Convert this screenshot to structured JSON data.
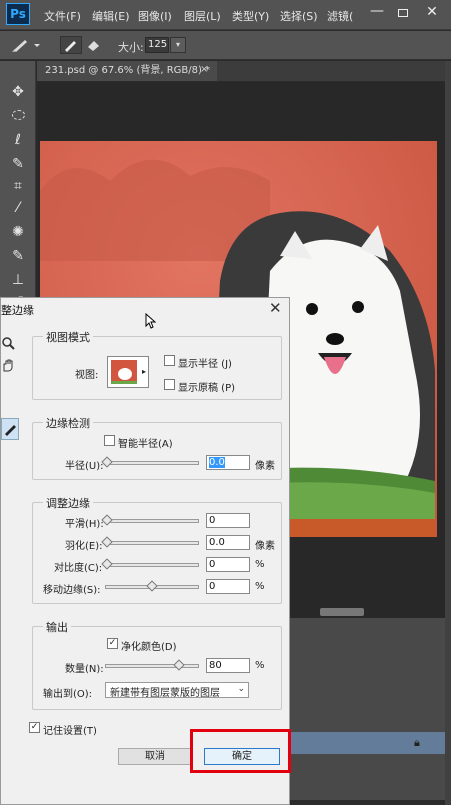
{
  "app": {
    "logo": "Ps",
    "menus": [
      "文件(F)",
      "编辑(E)",
      "图像(I)",
      "图层(L)",
      "类型(Y)",
      "选择(S)",
      "滤镜("
    ],
    "window_controls": {
      "minimize": "—",
      "close": "✕"
    }
  },
  "options_bar": {
    "size_label": "大小:",
    "size_value": "125",
    "dropdown_arrow": "▾"
  },
  "document": {
    "tab_title": "231.psd @ 67.6% (背景, RGB/8) *",
    "tab_close": "×"
  },
  "dialog": {
    "title": "整边缘",
    "close": "✕",
    "view_mode": {
      "legend": "视图模式",
      "view_label": "视图:",
      "show_radius": "显示半径 (J)",
      "show_original": "显示原稿 (P)"
    },
    "edge_detection": {
      "legend": "边缘检测",
      "smart_radius": "智能半径(A)",
      "radius_label": "半径(U):",
      "radius_value": "0.0",
      "radius_unit": "像素"
    },
    "adjust_edge": {
      "legend": "调整边缘",
      "smooth_label": "平滑(H):",
      "smooth_value": "0",
      "feather_label": "羽化(E):",
      "feather_value": "0.0",
      "feather_unit": "像素",
      "contrast_label": "对比度(C):",
      "contrast_value": "0",
      "contrast_unit": "%",
      "shift_label": "移动边缘(S):",
      "shift_value": "0",
      "shift_unit": "%"
    },
    "output": {
      "legend": "输出",
      "decontaminate": "净化颜色(D)",
      "decontaminate_checked": true,
      "amount_label": "数量(N):",
      "amount_value": "80",
      "amount_unit": "%",
      "amount_level": 0.8,
      "output_to_label": "输出到(O):",
      "output_to_value": "新建带有图层蒙版的图层"
    },
    "remember_settings": "记住设置(T)",
    "remember_checked": true,
    "cancel": "取消",
    "ok": "确定"
  },
  "colors": {
    "ps_blue": "#31a8ff",
    "overlay_red": "#d86a57",
    "highlight_box": "#e3000e",
    "layer_selected": "#627c99"
  }
}
